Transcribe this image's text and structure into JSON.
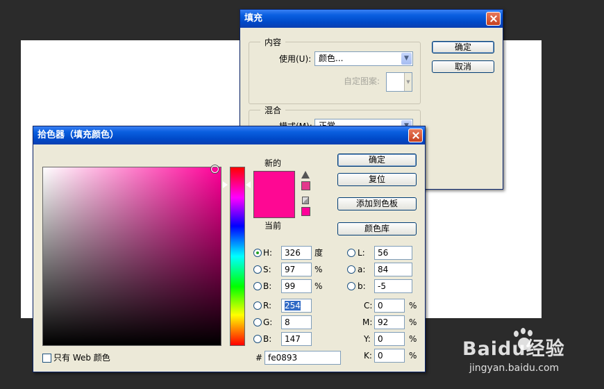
{
  "fill_dialog": {
    "title": "填充",
    "content_group": "内容",
    "use_label": "使用(U):",
    "use_value": "颜色...",
    "custom_pattern_label": "自定图案:",
    "blend_group": "混合",
    "mode_label": "模式(M):",
    "mode_value": "正常",
    "ok_label": "确定",
    "cancel_label": "取消"
  },
  "picker": {
    "title": "拾色器（填充颜色）",
    "new_label": "新的",
    "current_label": "当前",
    "ok_label": "确定",
    "reset_label": "复位",
    "add_swatch_label": "添加到色板",
    "library_label": "颜色库",
    "web_only_label": "只有 Web 颜色",
    "hsb": [
      {
        "label": "H:",
        "value": "326",
        "unit": "度"
      },
      {
        "label": "S:",
        "value": "97",
        "unit": "%"
      },
      {
        "label": "B:",
        "value": "99",
        "unit": "%"
      }
    ],
    "rgb": [
      {
        "label": "R:",
        "value": "254"
      },
      {
        "label": "G:",
        "value": "8"
      },
      {
        "label": "B:",
        "value": "147"
      }
    ],
    "lab": [
      {
        "label": "L:",
        "value": "56"
      },
      {
        "label": "a:",
        "value": "84"
      },
      {
        "label": "b:",
        "value": "-5"
      }
    ],
    "cmyk": [
      {
        "label": "C:",
        "value": "0",
        "unit": "%"
      },
      {
        "label": "M:",
        "value": "92",
        "unit": "%"
      },
      {
        "label": "Y:",
        "value": "0",
        "unit": "%"
      },
      {
        "label": "K:",
        "value": "0",
        "unit": "%"
      }
    ],
    "hex_label": "#",
    "hex_value": "fe0893",
    "colors": {
      "new": "#fe0893",
      "current": "#fe0893",
      "hue_base": "#ff0098"
    }
  },
  "watermark": {
    "brand": "Baidu经验",
    "url": "jingyan.baidu.com"
  }
}
